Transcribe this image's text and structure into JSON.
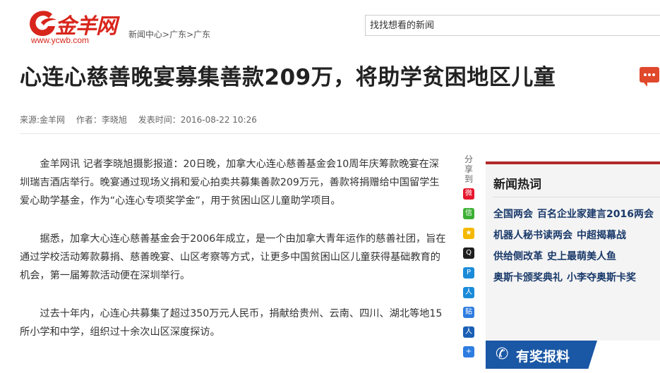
{
  "logo": {
    "name": "金羊网",
    "url": "www.ycwb.com"
  },
  "breadcrumb": [
    "新闻中心",
    ">",
    "广东",
    ">",
    "广东"
  ],
  "search": {
    "placeholder": "找找想看的新闻"
  },
  "article": {
    "title": "心连心慈善晚宴募集善款209万，将助学贫困地区儿童",
    "source": "来源:金羊网",
    "author": "作者：李晓旭",
    "published": "发表时间：2016-08-22 10:26",
    "paragraphs": [
      "金羊网讯 记者李晓旭摄影报道：20日晚，加拿大心连心慈善基金会10周年庆筹款晚宴在深圳瑞吉酒店举行。晚宴通过现场义捐和爱心拍卖共募集善款209万元，善款将捐赠给中国留学生爱心助学基金，作为“心连心专项奖学金”，用于贫困山区儿童助学项目。",
      "据悉，加拿大心连心慈善基金会于2006年成立，是一个由加拿大青年运作的慈善社团，旨在通过学校活动筹款募捐、慈善晚宴、山区考察等方式，让更多中国贫困山区儿童获得基础教育的机会，第一届筹款活动便在深圳举行。",
      "过去十年内，心连心共募集了超过350万元人民币，捐献给贵州、云南、四川、湖北等地15所小学和中学，组织过十余次山区深度探访。"
    ]
  },
  "share": {
    "label": "分享到",
    "buttons": [
      {
        "icon": "weibo-icon",
        "glyph": "微",
        "color": "#e6162d"
      },
      {
        "icon": "wechat-icon",
        "glyph": "信",
        "color": "#3cb034"
      },
      {
        "icon": "qzone-icon",
        "glyph": "★",
        "color": "#f5b800"
      },
      {
        "icon": "qq-icon",
        "glyph": "Q",
        "color": "#1f1f1f"
      },
      {
        "icon": "pengyou-icon",
        "glyph": "P",
        "color": "#1a8bd8"
      },
      {
        "icon": "renren-icon",
        "glyph": "人",
        "color": "#1a8bd8"
      },
      {
        "icon": "tieba-icon",
        "glyph": "贴",
        "color": "#2d7de0"
      },
      {
        "icon": "people-icon",
        "glyph": "人",
        "color": "#1a5fb4"
      },
      {
        "icon": "more-icon",
        "glyph": "+",
        "color": "#2d7de0"
      }
    ]
  },
  "sidebar": {
    "title": "新闻热词",
    "rows": [
      [
        "全国两会",
        "百名企业家建言2016两会"
      ],
      [
        "机器人秘书读两会",
        "中超揭幕战"
      ],
      [
        "供给侧改革",
        "史上最萌美人鱼"
      ],
      [
        "奥斯卡颁奖典礼",
        "小李夺奥斯卡奖"
      ]
    ]
  },
  "report": {
    "label": "有奖报料"
  },
  "colors": {
    "brand_red": "#d8251c",
    "sidebar_accent": "#b22a2a",
    "report_blue": "#1a57a5"
  }
}
